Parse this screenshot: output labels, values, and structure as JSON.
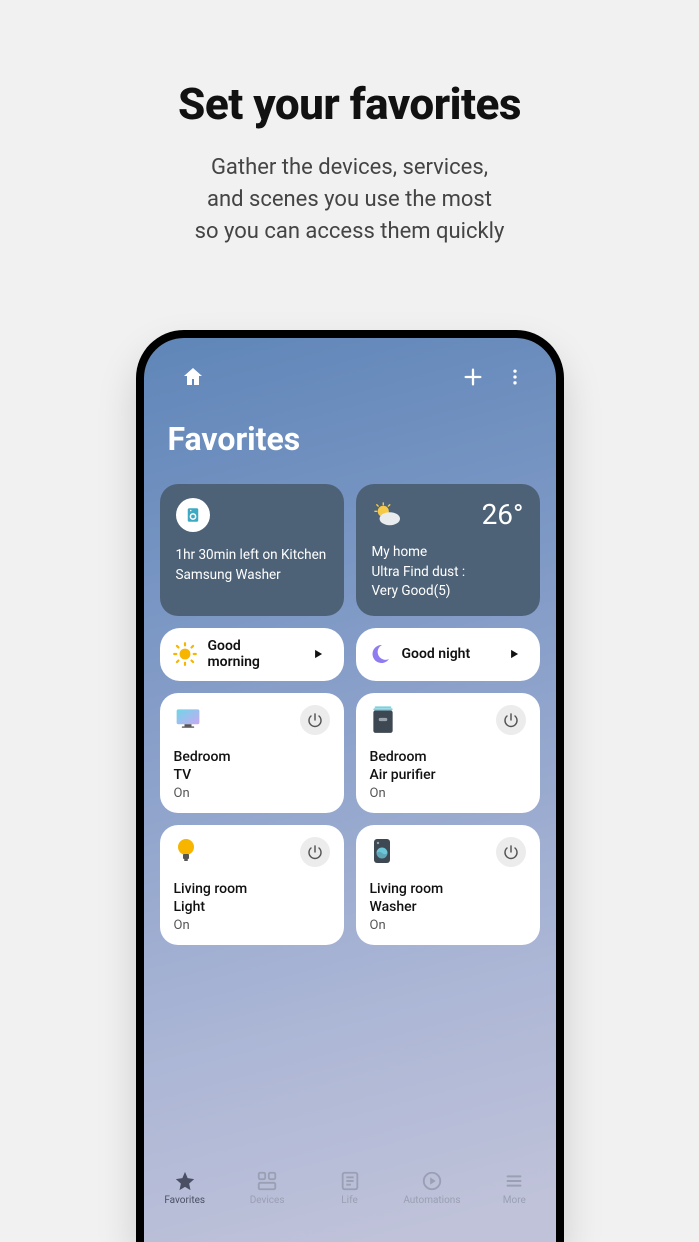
{
  "promo": {
    "title": "Set your favorites",
    "subtitle_line1": "Gather the devices, services,",
    "subtitle_line2": "and scenes you use the most",
    "subtitle_line3": "so you can access them quickly"
  },
  "page_title": "Favorites",
  "washer_card": {
    "text_line": "1hr 30min left on Kitchen Samsung Washer"
  },
  "weather_card": {
    "temp": "26°",
    "loc": "My home",
    "line2": "Ultra Find dust :",
    "line3": "Very Good(5)"
  },
  "scenes": [
    {
      "label": "Good morning"
    },
    {
      "label": "Good night"
    }
  ],
  "devices": [
    {
      "room": "Bedroom",
      "name": "TV",
      "state": "On"
    },
    {
      "room": "Bedroom",
      "name": "Air purifier",
      "state": "On"
    },
    {
      "room": "Living room",
      "name": "Light",
      "state": "On"
    },
    {
      "room": "Living room",
      "name": "Washer",
      "state": "On"
    }
  ],
  "nav": {
    "favorites": "Favorites",
    "devices": "Devices",
    "life": "Life",
    "automations": "Automations",
    "more": "More"
  }
}
